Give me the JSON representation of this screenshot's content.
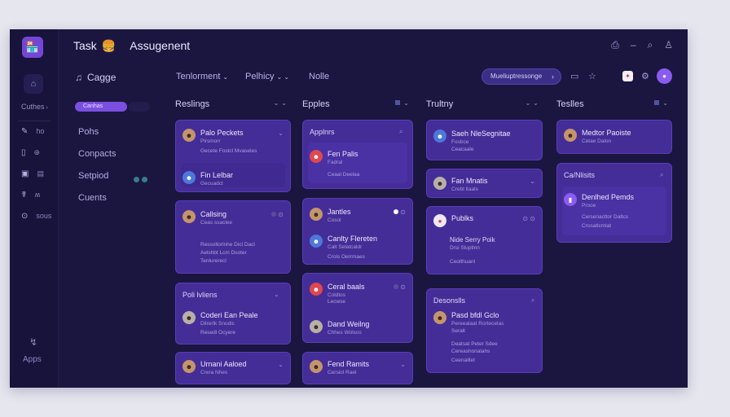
{
  "app": {
    "title": "Task",
    "title_emoji": "🍔",
    "subtitle": "Assugenent"
  },
  "rail": {
    "logo": "🏪",
    "button_icon": "home-icon",
    "group_label": "Cuthes",
    "items": [
      {
        "icon": "✎",
        "label": "ho"
      },
      {
        "icon": "▯",
        "label": "⊕"
      },
      {
        "icon": "▣",
        "label": "▤"
      },
      {
        "icon": "☤",
        "label": "ʍ"
      },
      {
        "icon": "⊙",
        "label": "sous"
      }
    ],
    "footer_icon": "↯",
    "footer_label": "Apps"
  },
  "side": {
    "title": "Cagge",
    "pill": "Canhas",
    "items": [
      "Pohs",
      "Conpacts",
      "Setpiod",
      "Cuents"
    ]
  },
  "toolbar": {
    "filters": [
      {
        "label": "Tenlorment"
      },
      {
        "label": "Pelhicy"
      },
      {
        "label": "Nolle"
      }
    ],
    "pill_label": "Mueliuptressonge"
  },
  "columns": [
    {
      "title": "Reslings",
      "cards": [
        {
          "rows": [
            {
              "name": "Palo Peckets",
              "sub": "Pirsmorr",
              "sub2": "Gecete Fostcl Mvaseles"
            },
            {
              "name": "Fin Lelbar",
              "sub": "Gecuadct"
            }
          ]
        },
        {
          "rows": [
            {
              "name": "Callsing",
              "sub": "Ceas ssaclee"
            }
          ],
          "lines": [
            "Ressollorlnhe Dicl Dacl",
            "Aelshbt Lcm Dsoter",
            "Tenlurerecl"
          ]
        },
        {
          "title": "Poli lvliens",
          "rows": [
            {
              "name": "Coderi Ean Peale",
              "sub": "Dilrerlk Snodic",
              "sub2": "Resedl Ocyere"
            }
          ]
        },
        {
          "rows": [
            {
              "name": "Urnani Aaloed",
              "sub": "Crera Nhes"
            }
          ]
        }
      ]
    },
    {
      "title": "Epples",
      "cards": [
        {
          "title": "Applnrs",
          "rows": [
            {
              "name": "Fen Palis",
              "sub": "Fadral",
              "sub2": "Ceaal Deelaa"
            }
          ]
        },
        {
          "rows": [
            {
              "name": "Jantles",
              "sub": "Cosol"
            },
            {
              "name": "Canlty Flereten",
              "sub": "Calt Selatcaldr",
              "sub2": "Crols Oerrmaes"
            }
          ]
        },
        {
          "rows": [
            {
              "name": "Ceral baals",
              "sub": "Coldtos",
              "sub2": "Lecwse"
            },
            {
              "name": "Dand Weilng",
              "sub": "Chhes Wolsco"
            }
          ]
        },
        {
          "rows": [
            {
              "name": "Fend Ramits",
              "sub": "Cersiol Rael"
            }
          ]
        }
      ]
    },
    {
      "title": "Trultny",
      "cards": [
        {
          "rows": [
            {
              "name": "Saeh NleSegnitae",
              "sub": "Fosbce",
              "sub2": "Ceacaale"
            }
          ]
        },
        {
          "rows": [
            {
              "name": "Fan Mnatis",
              "sub": "Crebt ltaals"
            }
          ]
        },
        {
          "title": "Publks",
          "lines": [
            "Nide Serry Poik",
            "Drsi Sluptlnn",
            "Ceolthuanl"
          ]
        },
        {
          "title": "Desonslls",
          "rows": [
            {
              "name": "Pasd bfdl Gclo",
              "sub": "Pereealaat Rortecelas",
              "sub2": "Seralt"
            }
          ],
          "lines": [
            "Deatsat Peter Sdee",
            "Cereashonalahs",
            "Ceenaillet"
          ]
        }
      ]
    },
    {
      "title": "Teslles",
      "cards": [
        {
          "rows": [
            {
              "name": "Medtor Paoiste",
              "sub": "Cetae Dalon"
            }
          ]
        },
        {
          "title": "Ca/Nlisits",
          "rows": [
            {
              "name": "Denlhed Pemds",
              "sub": "Prooe"
            }
          ],
          "lines": [
            "Cersenacttor Daltcs",
            "Crosatlcmlat"
          ]
        }
      ]
    }
  ]
}
